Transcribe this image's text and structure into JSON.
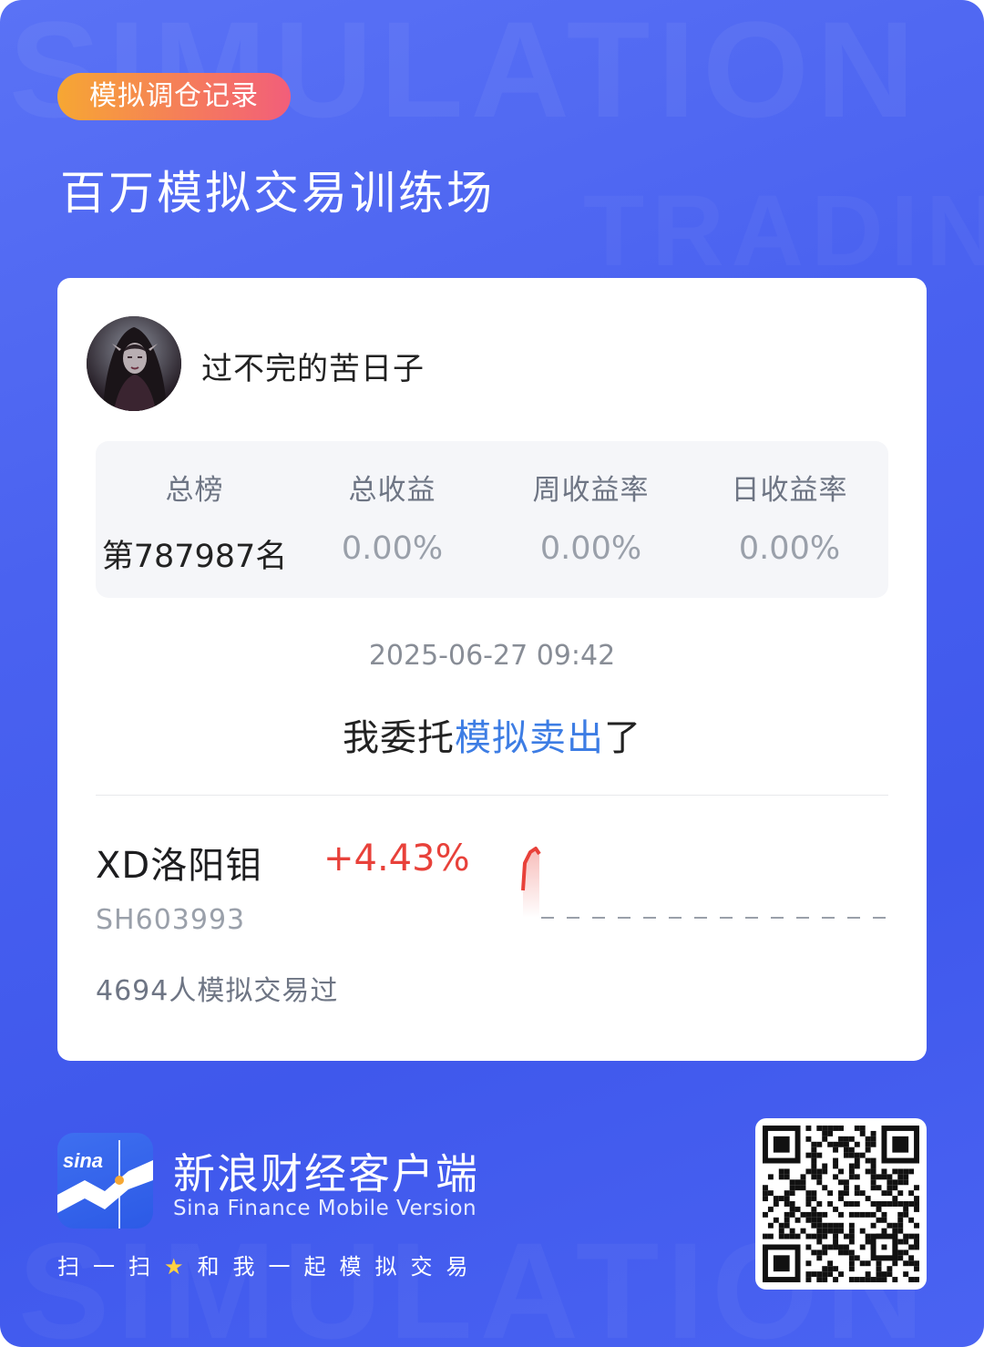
{
  "header": {
    "badge_label": "模拟调仓记录",
    "title": "百万模拟交易训练场"
  },
  "user": {
    "name": "过不完的苦日子",
    "avatar_icon": "user-avatar"
  },
  "stats": [
    {
      "label": "总榜",
      "value": "第787987名"
    },
    {
      "label": "总收益",
      "value": "0.00%"
    },
    {
      "label": "周收益率",
      "value": "0.00%"
    },
    {
      "label": "日收益率",
      "value": "0.00%"
    }
  ],
  "trade": {
    "timestamp": "2025-06-27 09:42",
    "action_prefix": "我委托",
    "action_highlight": "模拟卖出",
    "action_suffix": "了"
  },
  "stock": {
    "name": "XD洛阳钼",
    "change": "+4.43%",
    "code": "SH603993",
    "traders": "4694人模拟交易过"
  },
  "footer": {
    "app_name": "新浪财经客户端",
    "app_name_en": "Sina Finance Mobile Version",
    "logo_text": "sina",
    "scan_tip_prefix": "扫一扫",
    "scan_tip_suffix": "和我一起模拟交易",
    "qr_icon": "qr-code"
  },
  "colors": {
    "background": "#4a62f0",
    "accent_blue": "#3d7de4",
    "up_red": "#e8413a",
    "badge_start": "#f6a733",
    "badge_end": "#f25e7a"
  }
}
